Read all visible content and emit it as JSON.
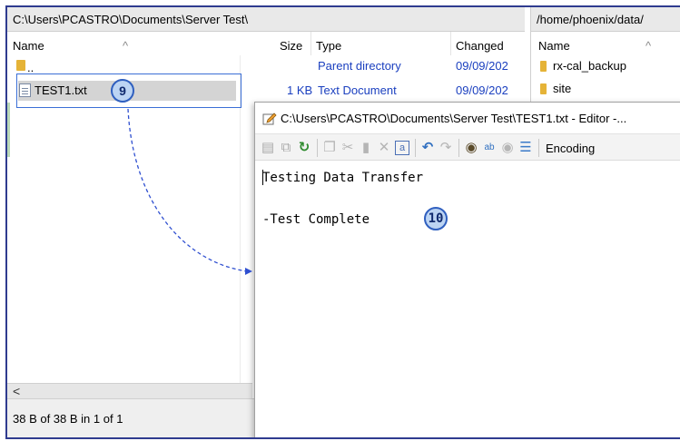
{
  "left_panel": {
    "path": "C:\\Users\\PCASTRO\\Documents\\Server Test\\",
    "columns": [
      "Name",
      "Size",
      "Type",
      "Changed"
    ],
    "rows": [
      {
        "name": "..",
        "size": "",
        "type": "Parent directory",
        "changed": "09/09/202"
      },
      {
        "name": "TEST1.txt",
        "size": "1 KB",
        "type": "Text Document",
        "changed": "09/09/202"
      }
    ],
    "status": "38 B of 38 B in 1 of 1",
    "scroll_left": "<"
  },
  "right_panel": {
    "path": "/home/phoenix/data/",
    "columns": [
      "Name"
    ],
    "rows": [
      {
        "name": "rx-cal_backup"
      },
      {
        "name": "site"
      }
    ]
  },
  "editor": {
    "title": "C:\\Users\\PCASTRO\\Documents\\Server Test\\TEST1.txt - Editor -...",
    "toolbar_encoding": "Encoding",
    "lines": [
      "Testing Data Transfer",
      "",
      "-Test Complete"
    ]
  },
  "annotations": {
    "step_9": "9",
    "step_10": "10"
  },
  "colors": {
    "frame": "#2f3b8f",
    "link_blue": "#1a3fbf",
    "badge_fill": "#bcd4f3",
    "badge_border": "#2f5fbf",
    "selection_box": "#3b6fd6"
  }
}
